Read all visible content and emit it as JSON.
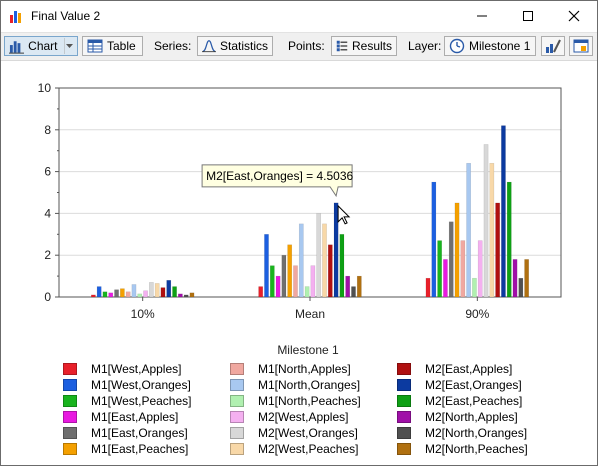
{
  "window": {
    "title": "Final Value 2"
  },
  "toolbar": {
    "chart_label": "Chart",
    "table_label": "Table",
    "series_label": "Series:",
    "series_value": "Statistics",
    "points_label": "Points:",
    "points_value": "Results",
    "layer_label": "Layer:",
    "layer_value": "Milestone 1"
  },
  "tooltip": {
    "text": "M2[East,Oranges] = 4.5036"
  },
  "chart_data": {
    "type": "bar",
    "title": "",
    "xlabel": "",
    "ylabel": "",
    "ylim": [
      0,
      10
    ],
    "yticks": [
      "0",
      "2",
      "4",
      "6",
      "8",
      "10"
    ],
    "grid": true,
    "legend_title": "Milestone 1",
    "legend_position": "bottom",
    "categories": [
      "10%",
      "Mean",
      "90%"
    ],
    "series": [
      {
        "name": "M1[West,Apples]",
        "color": "#e8202a",
        "values": [
          0.1,
          0.5,
          0.9
        ]
      },
      {
        "name": "M1[West,Oranges]",
        "color": "#1c5fe0",
        "values": [
          0.5,
          3.0,
          5.5
        ]
      },
      {
        "name": "M1[West,Peaches]",
        "color": "#19b41e",
        "values": [
          0.25,
          1.5,
          2.7
        ]
      },
      {
        "name": "M1[East,Apples]",
        "color": "#e81ae0",
        "values": [
          0.2,
          1.0,
          1.8
        ]
      },
      {
        "name": "M1[East,Oranges]",
        "color": "#6f6f6f",
        "values": [
          0.35,
          2.0,
          3.6
        ]
      },
      {
        "name": "M1[East,Peaches]",
        "color": "#f4a000",
        "values": [
          0.4,
          2.5,
          4.5
        ]
      },
      {
        "name": "M1[North,Apples]",
        "color": "#f0a8a0",
        "values": [
          0.25,
          1.5,
          2.7
        ]
      },
      {
        "name": "M1[North,Oranges]",
        "color": "#a8c8f0",
        "values": [
          0.6,
          3.5,
          6.4
        ]
      },
      {
        "name": "M1[North,Peaches]",
        "color": "#b0f0b0",
        "values": [
          0.15,
          0.5,
          0.9
        ]
      },
      {
        "name": "M2[West,Apples]",
        "color": "#f4b0f0",
        "values": [
          0.3,
          1.5,
          2.7
        ]
      },
      {
        "name": "M2[West,Oranges]",
        "color": "#d8d8d8",
        "values": [
          0.7,
          4.0,
          7.3
        ]
      },
      {
        "name": "M2[West,Peaches]",
        "color": "#f8d8a8",
        "values": [
          0.65,
          3.5,
          6.4
        ]
      },
      {
        "name": "M2[East,Apples]",
        "color": "#b01010",
        "values": [
          0.45,
          2.5,
          4.5
        ]
      },
      {
        "name": "M2[East,Oranges]",
        "color": "#0c3aa0",
        "values": [
          0.8,
          4.5036,
          8.2
        ]
      },
      {
        "name": "M2[East,Peaches]",
        "color": "#0ea014",
        "values": [
          0.5,
          3.0,
          5.5
        ]
      },
      {
        "name": "M2[North,Apples]",
        "color": "#a010a8",
        "values": [
          0.15,
          1.0,
          1.8
        ]
      },
      {
        "name": "M2[North,Oranges]",
        "color": "#505050",
        "values": [
          0.1,
          0.5,
          0.9
        ]
      },
      {
        "name": "M2[North,Peaches]",
        "color": "#b07010",
        "values": [
          0.2,
          1.0,
          1.8
        ]
      }
    ]
  }
}
